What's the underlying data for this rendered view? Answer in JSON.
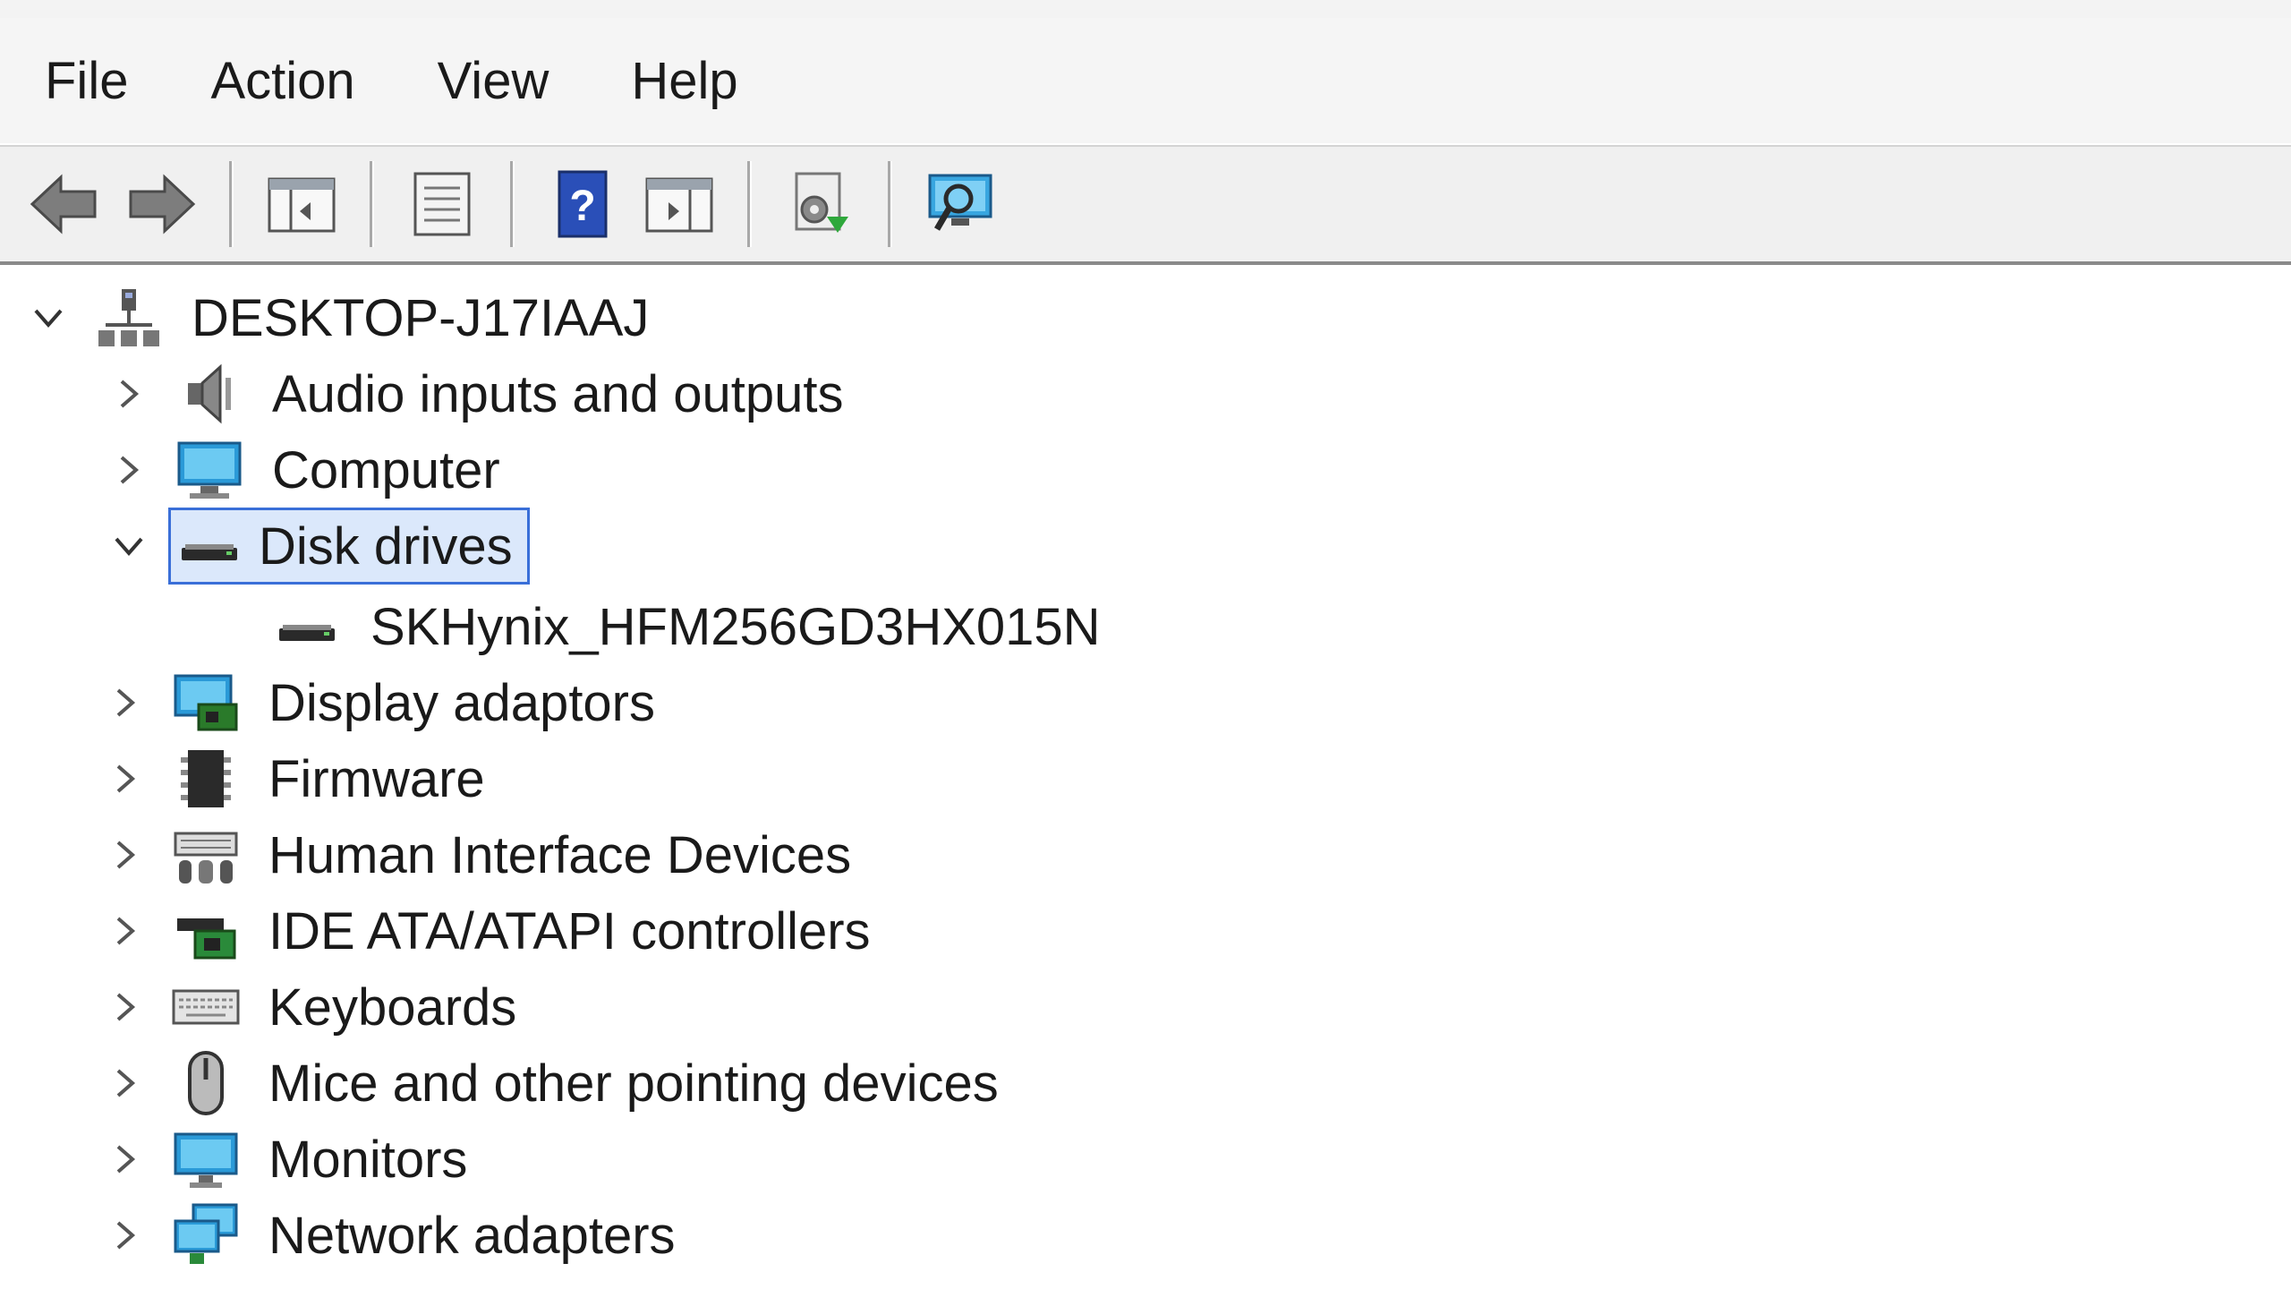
{
  "menu": {
    "items": [
      "File",
      "Action",
      "View",
      "Help"
    ]
  },
  "toolbar": {
    "buttons": [
      "back-icon",
      "forward-icon",
      "console-tree-icon",
      "properties-icon",
      "help-icon",
      "show-hide-action-pane-icon",
      "update-driver-icon",
      "scan-hardware-icon"
    ]
  },
  "tree": {
    "root": {
      "label": "DESKTOP-J17IAAJ",
      "expanded": true
    },
    "categories": [
      {
        "label": "Audio inputs and outputs",
        "icon": "speaker-icon",
        "expanded": false
      },
      {
        "label": "Computer",
        "icon": "computer-icon",
        "expanded": false
      },
      {
        "label": "Disk drives",
        "icon": "disk-drive-icon",
        "expanded": true,
        "selected": true,
        "children": [
          {
            "label": "SKHynix_HFM256GD3HX015N",
            "icon": "disk-drive-icon"
          }
        ]
      },
      {
        "label": "Display adaptors",
        "icon": "display-adapter-icon",
        "expanded": false
      },
      {
        "label": "Firmware",
        "icon": "firmware-icon",
        "expanded": false
      },
      {
        "label": "Human Interface Devices",
        "icon": "hid-icon",
        "expanded": false
      },
      {
        "label": "IDE ATA/ATAPI controllers",
        "icon": "ide-controller-icon",
        "expanded": false
      },
      {
        "label": "Keyboards",
        "icon": "keyboard-icon",
        "expanded": false
      },
      {
        "label": "Mice and other pointing devices",
        "icon": "mouse-icon",
        "expanded": false
      },
      {
        "label": "Monitors",
        "icon": "monitor-icon",
        "expanded": false
      },
      {
        "label": "Network adapters",
        "icon": "network-adapter-icon",
        "expanded": false
      }
    ]
  },
  "colors": {
    "selection_border": "#3a6fd8",
    "selection_fill": "#dbe8fb",
    "toolbar_bg": "#f0f0f0"
  }
}
